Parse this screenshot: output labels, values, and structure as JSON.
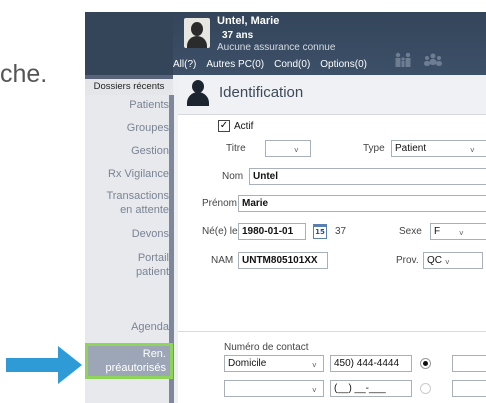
{
  "background": {
    "text": "che."
  },
  "patient": {
    "name": "Untel, Marie",
    "age": "37 ans",
    "insurance": "Aucune assurance connue"
  },
  "tabs": [
    "All(?)",
    "Autres PC(0)",
    "Cond(0)",
    "Options(0)"
  ],
  "sidebar": {
    "recent": "Dossiers récents",
    "items": [
      "Patients",
      "Groupes",
      "Gestion",
      "Rx Vigilance",
      "Transactions",
      "en attente",
      "Devons",
      "Portail",
      "patient",
      "Ren.",
      "préautorisés",
      "Agenda"
    ]
  },
  "identification": {
    "title": "Identification",
    "actif_label": "Actif",
    "actif_mark": "✓",
    "titre_label": "Titre",
    "type_label": "Type",
    "type_value": "Patient",
    "nom_label": "Nom",
    "nom_value": "Untel",
    "prenom_label": "Prénom",
    "prenom_value": "Marie",
    "dob_label": "Né(e) le",
    "dob_value": "1980-01-01",
    "dob_cal": "15",
    "age_short": "37",
    "sexe_label": "Sexe",
    "sexe_value": "F",
    "nam_label": "NAM",
    "nam_value": "UNTM805101XX",
    "prov_label": "Prov.",
    "prov_value": "QC"
  },
  "contact": {
    "label": "Numéro de contact",
    "row1_type": "Domicile",
    "row1_phone": "450) 444-4444",
    "row2_phone": "(__) __-___"
  },
  "chevron": "˅",
  "colors": {
    "highlight_border": "#8ed35a",
    "arrow": "#2f9bd6",
    "header": "#34455a"
  }
}
